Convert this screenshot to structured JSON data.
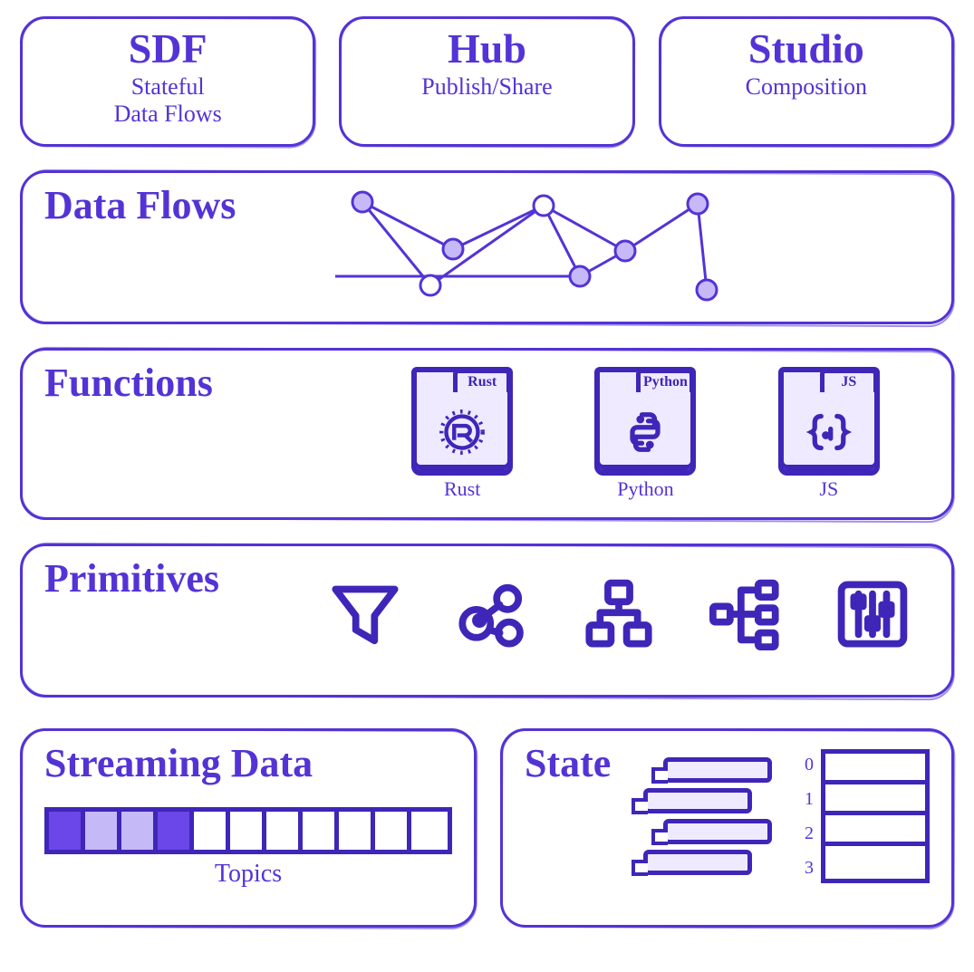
{
  "colors": {
    "ink": "#5433d6",
    "ink_dark": "#3f26b8",
    "fill": "#c6b9f7",
    "fill_dark": "#6b46e8",
    "pale": "#efeaff"
  },
  "top_row": {
    "sdf": {
      "title": "SDF",
      "subtitle": "Stateful\nData Flows"
    },
    "hub": {
      "title": "Hub",
      "subtitle": "Publish/Share"
    },
    "studio": {
      "title": "Studio",
      "subtitle": "Composition"
    }
  },
  "sections": {
    "data_flows": {
      "title": "Data Flows"
    },
    "functions": {
      "title": "Functions",
      "items": [
        {
          "tag": "Rust",
          "caption": "Rust"
        },
        {
          "tag": "Python",
          "caption": "Python"
        },
        {
          "tag": "JS",
          "caption": "JS"
        }
      ]
    },
    "primitives": {
      "title": "Primitives",
      "icons": [
        "filter",
        "transform",
        "merge",
        "route",
        "tune"
      ]
    },
    "streaming": {
      "title": "Streaming Data",
      "caption": "Topics",
      "cells": 11,
      "filled": 4
    },
    "state": {
      "title": "State",
      "indices": [
        "0",
        "1",
        "2",
        "3"
      ],
      "rows": 4
    }
  }
}
